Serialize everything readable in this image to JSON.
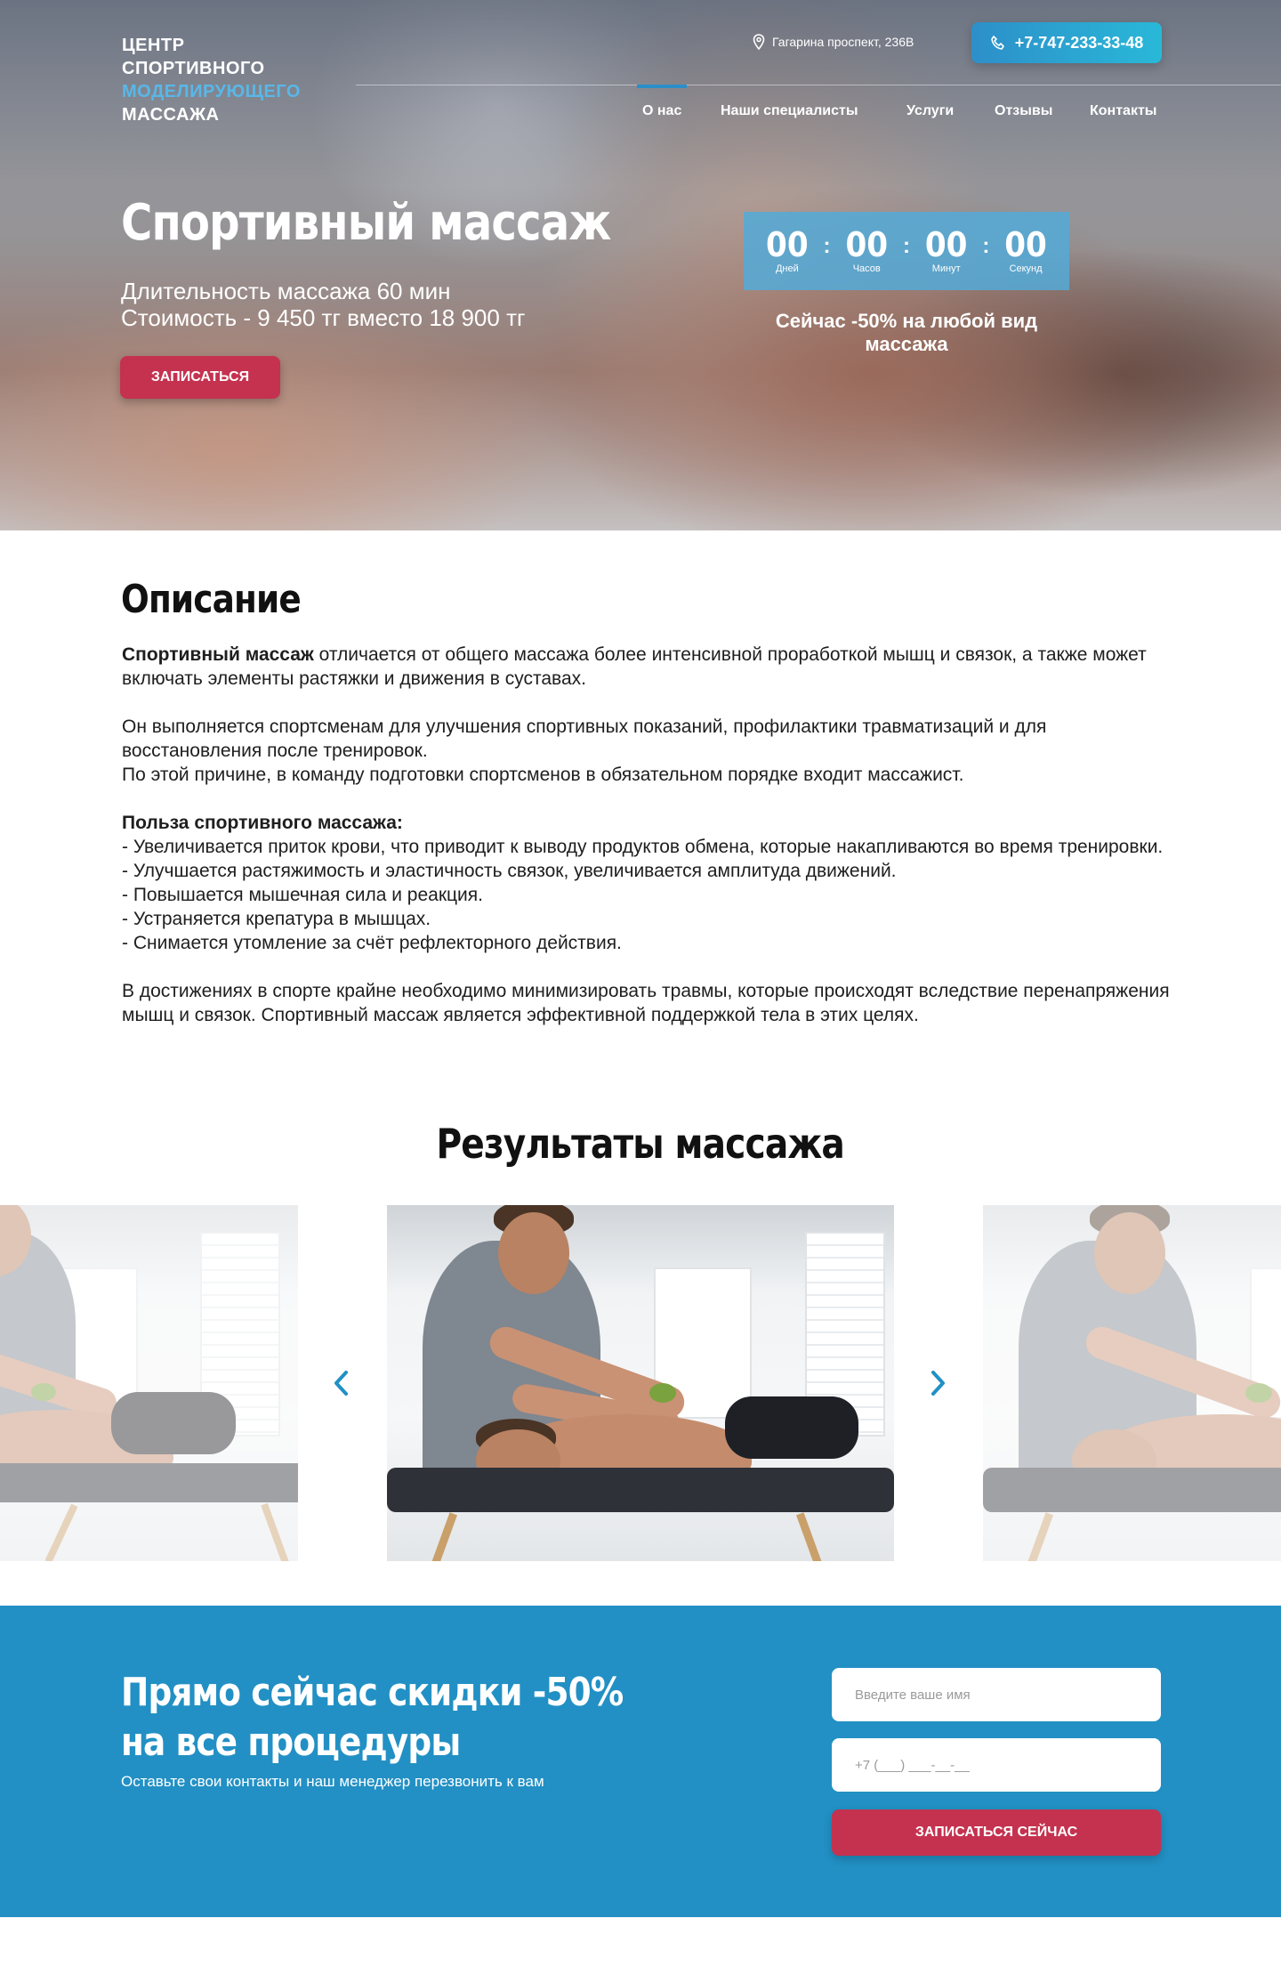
{
  "header": {
    "logo": [
      "ЦЕНТР",
      "СПОРТИВНОГО",
      "МОДЕЛИРУЮЩЕГО",
      "МАССАЖА"
    ],
    "address": "Гагарина проспект, 236В",
    "phone": "+7-747-233-33-48",
    "nav": [
      {
        "label": "О нас",
        "active": true
      },
      {
        "label": "Наши специалисты",
        "active": false
      },
      {
        "label": "Услуги",
        "active": false
      },
      {
        "label": "Отзывы",
        "active": false
      },
      {
        "label": "Контакты",
        "active": false
      }
    ]
  },
  "hero": {
    "title": "Спортивный массаж",
    "duration": "Длительность массажа 60 мин",
    "price": "Стоимость - 9 450 тг вместо 18 900 тг",
    "button": "ЗАПИСАТЬСЯ",
    "timer": [
      {
        "value": "00",
        "label": "Дней"
      },
      {
        "value": "00",
        "label": "Часов"
      },
      {
        "value": "00",
        "label": "Минут"
      },
      {
        "value": "00",
        "label": "Секунд"
      }
    ],
    "promo": "Сейчас -50% на любой вид массажа"
  },
  "description": {
    "title": "Описание",
    "p1_bold": "Спортивный массаж",
    "p1_rest": " отличается от общего массажа более интенсивной проработкой мышц и связок, а также может включать элементы растяжки и движения в суставах.",
    "p2": "Он выполняется спортсменам для улучшения спортивных показаний, профилактики травматизаций и для восстановления после тренировок.",
    "p3": "По этой причине, в команду подготовки спортсменов в обязательном порядке входит массажист.",
    "benefits_title": "Польза спортивного массажа:",
    "benefits": [
      "- Увеличивается приток крови, что приводит к выводу продуктов обмена, которые накапливаются во время тренировки.",
      "- Улучшается растяжимость и эластичность связок, увеличивается амплитуда движений.",
      "- Повышается мышечная сила и реакция.",
      "- Устраняется крепатура в мышцах.",
      "- Снимается утомление за счёт рефлекторного действия."
    ],
    "p4": "В достижениях в спорте крайне необходимо минимизировать травмы, которые происходят вследствие перенапряжения мышц и связок. Спортивный массаж является эффективной поддержкой тела в этих целях."
  },
  "results": {
    "title": "Результаты массажа"
  },
  "cta": {
    "title_line1": "Прямо сейчас скидки -50%",
    "title_line2": "на все процедуры",
    "subtitle": "Оставьте свои контакты и наш менеджер перезвонить к вам",
    "name_placeholder": "Введите ваше имя",
    "phone_placeholder": "+7 (___) ___-__-__",
    "button": "ЗАПИСАТЬСЯ СЕЙЧАС"
  },
  "colors": {
    "accent_blue": "#2290c4",
    "accent_red": "#c4324f",
    "logo_accent": "#59b7e8"
  }
}
